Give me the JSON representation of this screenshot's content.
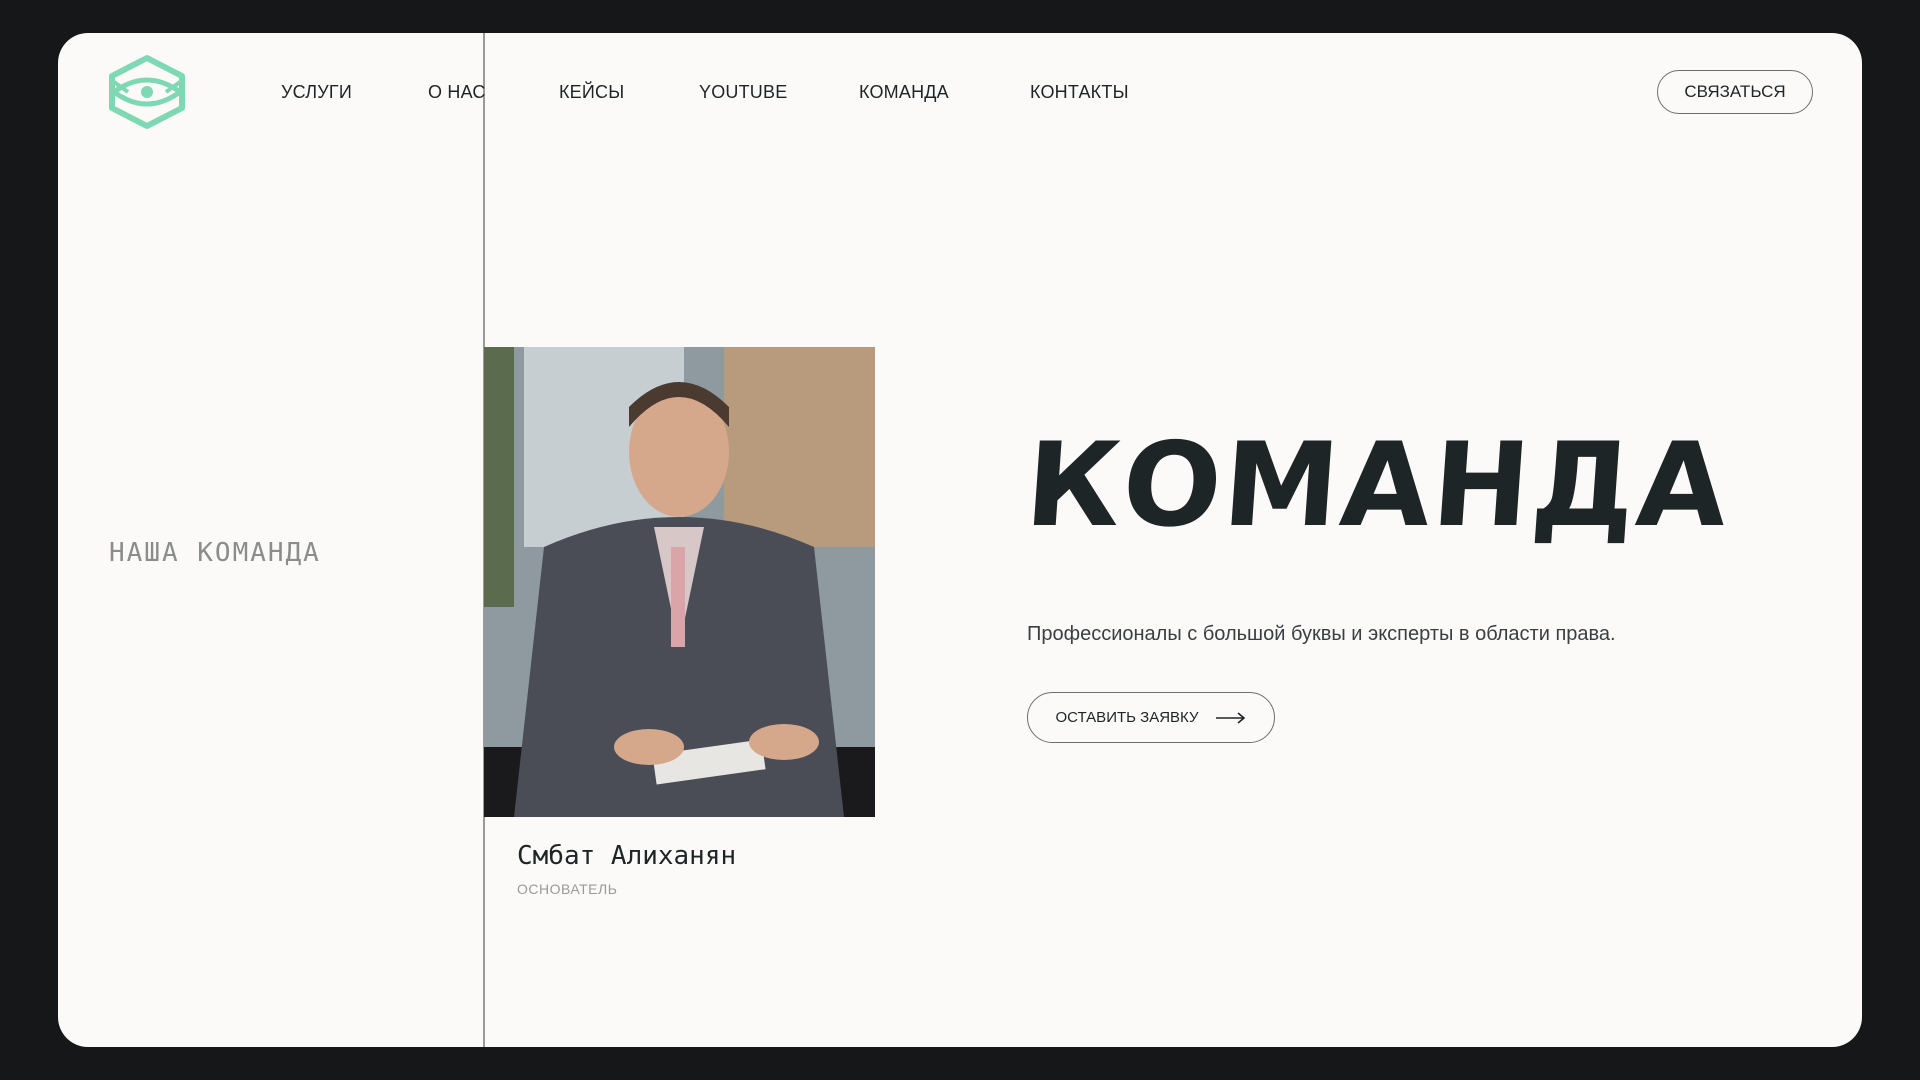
{
  "nav": {
    "items": [
      {
        "label": "УСЛУГИ"
      },
      {
        "label": "О НАС"
      },
      {
        "label": "КЕЙСЫ"
      },
      {
        "label": "YOUTUBE"
      },
      {
        "label": "КОМАНДА"
      },
      {
        "label": "КОНТАКТЫ"
      }
    ],
    "contact_label": "СВЯЗАТЬСЯ"
  },
  "side": {
    "label": "НАША КОМАНДА"
  },
  "member": {
    "name": "Смбат Алиханян",
    "role": "ОСНОВАТЕЛЬ",
    "photo_icon": "person-photo"
  },
  "hero": {
    "title": "КОМАНДА",
    "tagline": "Профессионалы с большой буквы и эксперты в области права.",
    "cta_label": "ОСТАВИТЬ ЗАЯВКУ",
    "cta_icon": "arrow-right-icon"
  },
  "colors": {
    "background": "#161718",
    "card": "#fbfaf8",
    "logo": "#7ed8b4",
    "text": "#1e2527",
    "muted": "#8a8d8c"
  }
}
